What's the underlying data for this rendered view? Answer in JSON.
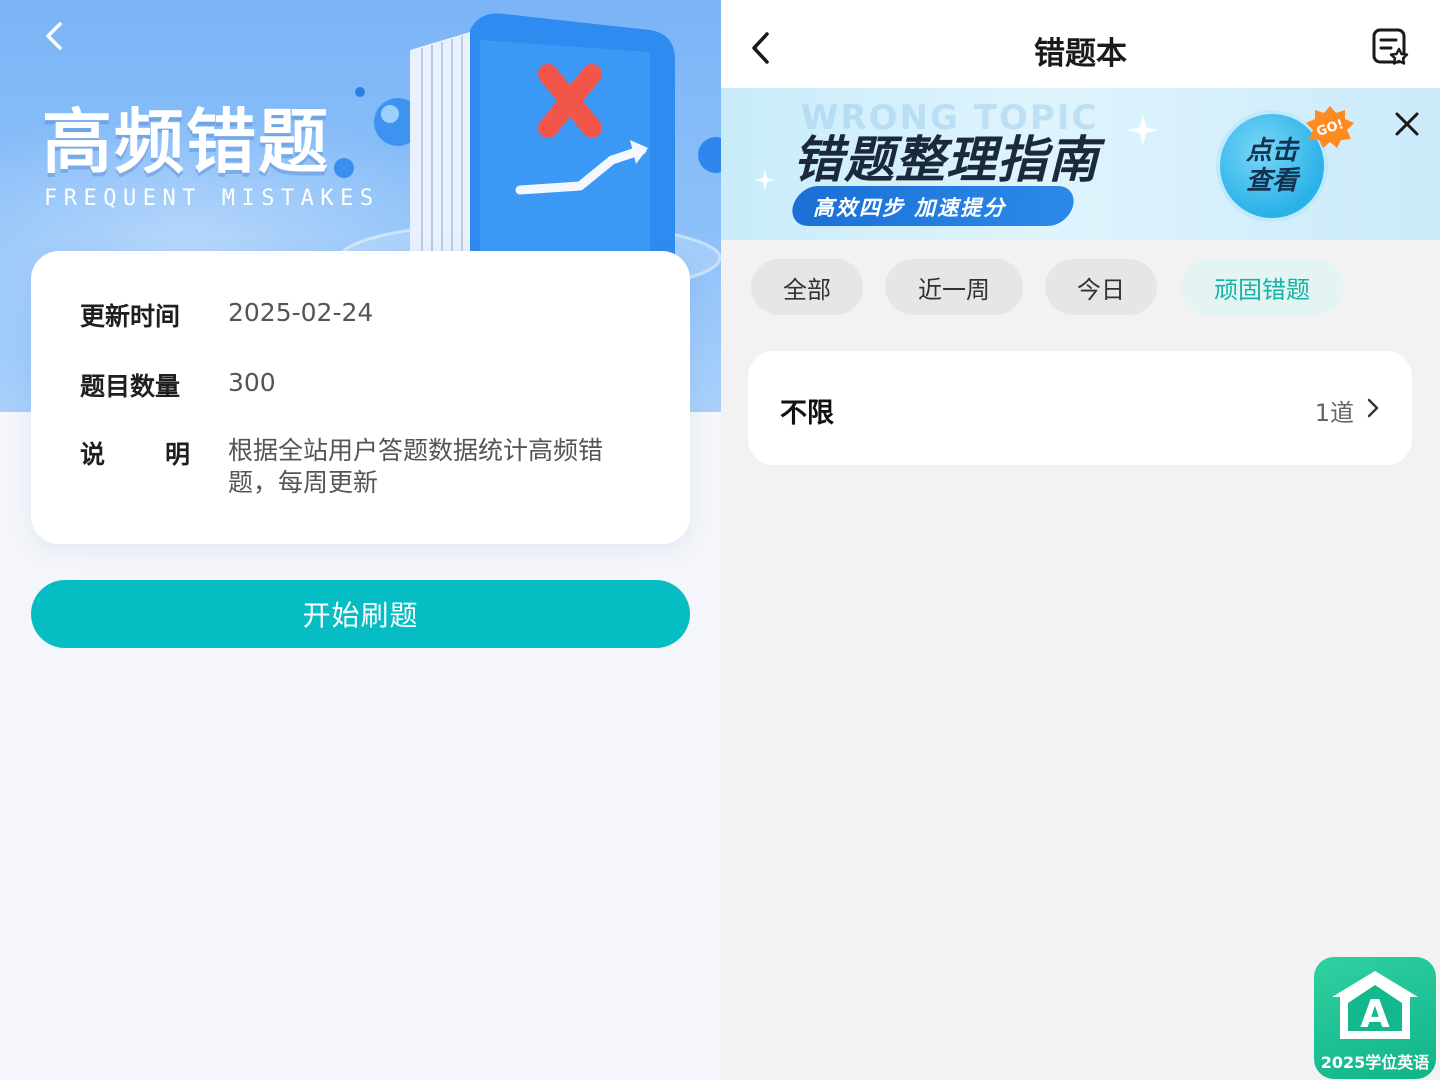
{
  "left": {
    "hero": {
      "title": "高频错题",
      "subtitle": "FREQUENT MISTAKES"
    },
    "info": {
      "update_label": "更新时间",
      "update_value": "2025-02-24",
      "count_label": "题目数量",
      "count_value": "300",
      "desc_label_1": "说",
      "desc_label_2": "明",
      "desc_value": "根据全站用户答题数据统计高频错题，每周更新"
    },
    "start_button": "开始刷题"
  },
  "right": {
    "title": "错题本",
    "banner": {
      "ghost_text": "WRONG TOPIC",
      "title": "错题整理指南",
      "subtitle": "高效四步  加速提分",
      "cta_line1": "点击",
      "cta_line2": "查看",
      "badge": "GO!"
    },
    "tabs": [
      {
        "label": "全部",
        "active": false
      },
      {
        "label": "近一周",
        "active": false
      },
      {
        "label": "今日",
        "active": false
      },
      {
        "label": "顽固错题",
        "active": true
      }
    ],
    "list": [
      {
        "title": "不限",
        "count": "1道"
      }
    ],
    "fab_label": "2025学位英语"
  },
  "colors": {
    "accent_teal": "#05bdc3",
    "active_tab_text": "#13b3a6",
    "hero_blue": "#7bb4f7"
  }
}
